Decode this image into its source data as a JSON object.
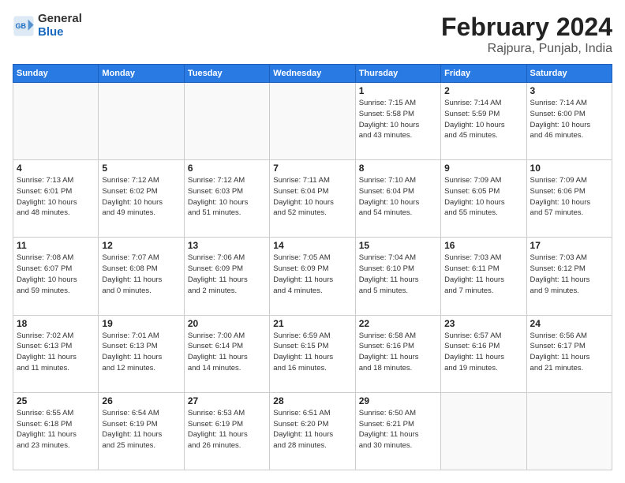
{
  "header": {
    "logo_line1": "General",
    "logo_line2": "Blue",
    "month_year": "February 2024",
    "location": "Rajpura, Punjab, India"
  },
  "weekdays": [
    "Sunday",
    "Monday",
    "Tuesday",
    "Wednesday",
    "Thursday",
    "Friday",
    "Saturday"
  ],
  "weeks": [
    [
      {
        "day": "",
        "detail": ""
      },
      {
        "day": "",
        "detail": ""
      },
      {
        "day": "",
        "detail": ""
      },
      {
        "day": "",
        "detail": ""
      },
      {
        "day": "1",
        "detail": "Sunrise: 7:15 AM\nSunset: 5:58 PM\nDaylight: 10 hours\nand 43 minutes."
      },
      {
        "day": "2",
        "detail": "Sunrise: 7:14 AM\nSunset: 5:59 PM\nDaylight: 10 hours\nand 45 minutes."
      },
      {
        "day": "3",
        "detail": "Sunrise: 7:14 AM\nSunset: 6:00 PM\nDaylight: 10 hours\nand 46 minutes."
      }
    ],
    [
      {
        "day": "4",
        "detail": "Sunrise: 7:13 AM\nSunset: 6:01 PM\nDaylight: 10 hours\nand 48 minutes."
      },
      {
        "day": "5",
        "detail": "Sunrise: 7:12 AM\nSunset: 6:02 PM\nDaylight: 10 hours\nand 49 minutes."
      },
      {
        "day": "6",
        "detail": "Sunrise: 7:12 AM\nSunset: 6:03 PM\nDaylight: 10 hours\nand 51 minutes."
      },
      {
        "day": "7",
        "detail": "Sunrise: 7:11 AM\nSunset: 6:04 PM\nDaylight: 10 hours\nand 52 minutes."
      },
      {
        "day": "8",
        "detail": "Sunrise: 7:10 AM\nSunset: 6:04 PM\nDaylight: 10 hours\nand 54 minutes."
      },
      {
        "day": "9",
        "detail": "Sunrise: 7:09 AM\nSunset: 6:05 PM\nDaylight: 10 hours\nand 55 minutes."
      },
      {
        "day": "10",
        "detail": "Sunrise: 7:09 AM\nSunset: 6:06 PM\nDaylight: 10 hours\nand 57 minutes."
      }
    ],
    [
      {
        "day": "11",
        "detail": "Sunrise: 7:08 AM\nSunset: 6:07 PM\nDaylight: 10 hours\nand 59 minutes."
      },
      {
        "day": "12",
        "detail": "Sunrise: 7:07 AM\nSunset: 6:08 PM\nDaylight: 11 hours\nand 0 minutes."
      },
      {
        "day": "13",
        "detail": "Sunrise: 7:06 AM\nSunset: 6:09 PM\nDaylight: 11 hours\nand 2 minutes."
      },
      {
        "day": "14",
        "detail": "Sunrise: 7:05 AM\nSunset: 6:09 PM\nDaylight: 11 hours\nand 4 minutes."
      },
      {
        "day": "15",
        "detail": "Sunrise: 7:04 AM\nSunset: 6:10 PM\nDaylight: 11 hours\nand 5 minutes."
      },
      {
        "day": "16",
        "detail": "Sunrise: 7:03 AM\nSunset: 6:11 PM\nDaylight: 11 hours\nand 7 minutes."
      },
      {
        "day": "17",
        "detail": "Sunrise: 7:03 AM\nSunset: 6:12 PM\nDaylight: 11 hours\nand 9 minutes."
      }
    ],
    [
      {
        "day": "18",
        "detail": "Sunrise: 7:02 AM\nSunset: 6:13 PM\nDaylight: 11 hours\nand 11 minutes."
      },
      {
        "day": "19",
        "detail": "Sunrise: 7:01 AM\nSunset: 6:13 PM\nDaylight: 11 hours\nand 12 minutes."
      },
      {
        "day": "20",
        "detail": "Sunrise: 7:00 AM\nSunset: 6:14 PM\nDaylight: 11 hours\nand 14 minutes."
      },
      {
        "day": "21",
        "detail": "Sunrise: 6:59 AM\nSunset: 6:15 PM\nDaylight: 11 hours\nand 16 minutes."
      },
      {
        "day": "22",
        "detail": "Sunrise: 6:58 AM\nSunset: 6:16 PM\nDaylight: 11 hours\nand 18 minutes."
      },
      {
        "day": "23",
        "detail": "Sunrise: 6:57 AM\nSunset: 6:16 PM\nDaylight: 11 hours\nand 19 minutes."
      },
      {
        "day": "24",
        "detail": "Sunrise: 6:56 AM\nSunset: 6:17 PM\nDaylight: 11 hours\nand 21 minutes."
      }
    ],
    [
      {
        "day": "25",
        "detail": "Sunrise: 6:55 AM\nSunset: 6:18 PM\nDaylight: 11 hours\nand 23 minutes."
      },
      {
        "day": "26",
        "detail": "Sunrise: 6:54 AM\nSunset: 6:19 PM\nDaylight: 11 hours\nand 25 minutes."
      },
      {
        "day": "27",
        "detail": "Sunrise: 6:53 AM\nSunset: 6:19 PM\nDaylight: 11 hours\nand 26 minutes."
      },
      {
        "day": "28",
        "detail": "Sunrise: 6:51 AM\nSunset: 6:20 PM\nDaylight: 11 hours\nand 28 minutes."
      },
      {
        "day": "29",
        "detail": "Sunrise: 6:50 AM\nSunset: 6:21 PM\nDaylight: 11 hours\nand 30 minutes."
      },
      {
        "day": "",
        "detail": ""
      },
      {
        "day": "",
        "detail": ""
      }
    ]
  ]
}
